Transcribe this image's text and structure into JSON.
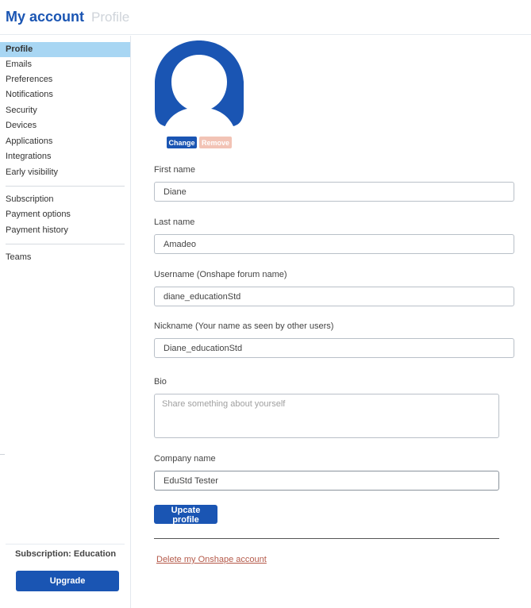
{
  "header": {
    "title": "My account",
    "subtitle": "Profile"
  },
  "sidebar": {
    "groups": [
      [
        "Profile",
        "Emails",
        "Preferences",
        "Notifications",
        "Security",
        "Devices",
        "Applications",
        "Integrations",
        "Early visibility"
      ],
      [
        "Subscription",
        "Payment options",
        "Payment history"
      ],
      [
        "Teams"
      ]
    ],
    "items": [
      {
        "label": "Profile",
        "active": true
      },
      {
        "label": "Emails"
      },
      {
        "label": "Preferences"
      },
      {
        "label": "Notifications"
      },
      {
        "label": "Security"
      },
      {
        "label": "Devices"
      },
      {
        "label": "Applications"
      },
      {
        "label": "Integrations"
      },
      {
        "label": "Early visibility"
      },
      {
        "label": "Subscription"
      },
      {
        "label": "Payment options"
      },
      {
        "label": "Payment history"
      },
      {
        "label": "Teams"
      }
    ],
    "subscription_label": "Subscription: Education",
    "upgrade_label": "Upgrade"
  },
  "avatar": {
    "icon": "user-silhouette-icon",
    "color": "#1a55b3",
    "change_label": "Change",
    "remove_label": "Remove"
  },
  "form": {
    "first_name": {
      "label": "First name",
      "value": "Diane"
    },
    "last_name": {
      "label": "Last name",
      "value": "Amadeo"
    },
    "username": {
      "label": "Username (Onshape forum name)",
      "value": "diane_educationStd"
    },
    "nickname": {
      "label": "Nickname (Your name as seen by other users)",
      "value": "Diane_educationStd"
    },
    "bio": {
      "label": "Bio",
      "value": "",
      "placeholder": "Share something about yourself"
    },
    "company": {
      "label": "Company name",
      "value": "EduStd Tester"
    },
    "update_label": "Upcate profile",
    "delete_label": "Delete my Onshape account"
  },
  "colors": {
    "accent": "#1a55b3",
    "active_nav": "#a8d6f3",
    "remove_button": "#f2c3b5",
    "danger_link": "#b55a4a"
  }
}
